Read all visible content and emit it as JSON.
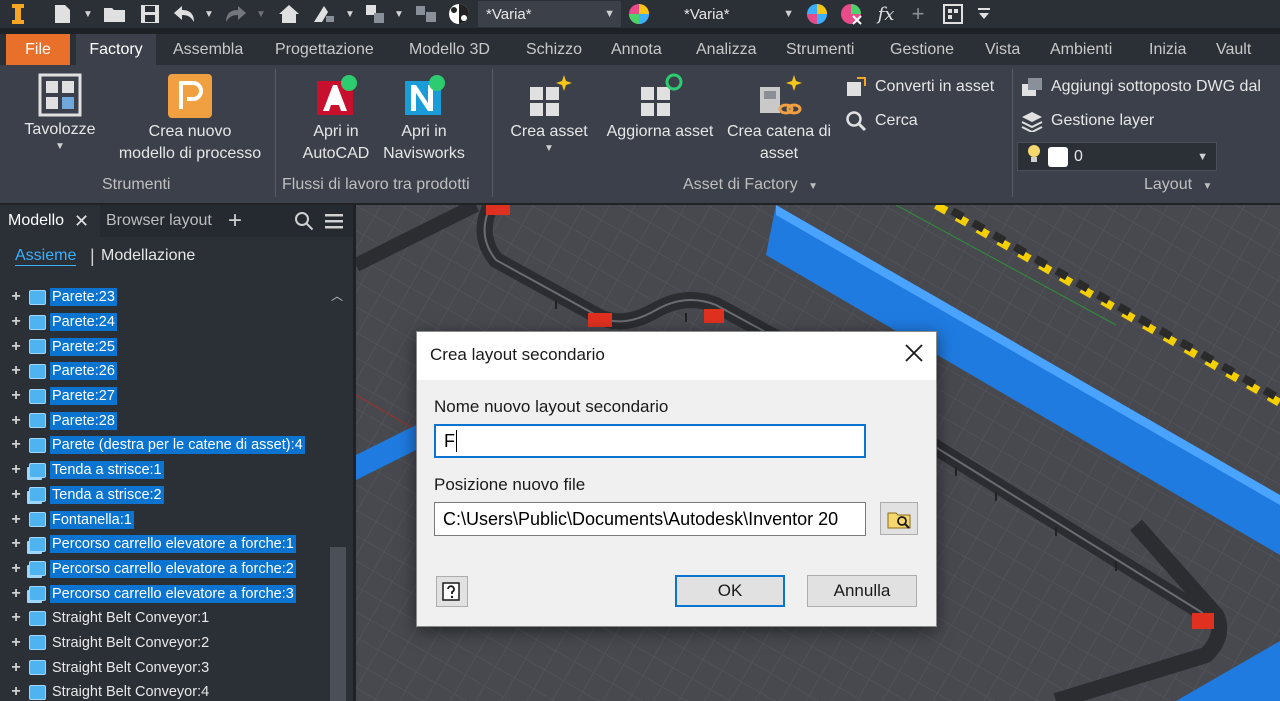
{
  "quick_access": {
    "style_select_1": "*Varia*",
    "style_select_2": "*Varia*",
    "fx_label": "fx"
  },
  "ribbon_tabs": [
    "File",
    "Factory",
    "Assembla",
    "Progettazione",
    "Modello 3D",
    "Schizzo",
    "Annota",
    "Analizza",
    "Strumenti",
    "Gestione",
    "Vista",
    "Ambienti",
    "Inizia",
    "Vault"
  ],
  "active_tab": "Factory",
  "ribbon": {
    "tavolozze": "Tavolozze",
    "crea_nuovo_1": "Crea nuovo",
    "crea_nuovo_2": "modello di processo",
    "apri_autocad_1": "Apri in",
    "apri_autocad_2": "AutoCAD",
    "apri_navis_1": "Apri in",
    "apri_navis_2": "Navisworks",
    "crea_asset": "Crea asset",
    "aggiorna_asset": "Aggiorna asset",
    "crea_catena_1": "Crea catena di",
    "crea_catena_2": "asset",
    "converti": "Converti in asset",
    "cerca": "Cerca",
    "aggiungi_dwg": "Aggiungi sottoposto DWG dal",
    "gestione_layer": "Gestione layer",
    "layer_value": "0",
    "panel_strumenti": "Strumenti",
    "panel_flussi": "Flussi di lavoro tra prodotti",
    "panel_asset": "Asset di Factory",
    "panel_layout": "Layout"
  },
  "browser": {
    "tab_modello": "Modello",
    "tab_layout": "Browser layout",
    "sub_assieme": "Assieme",
    "sub_modellazione": "Modellazione",
    "items": [
      {
        "label": "Parete:23",
        "hl": true,
        "multi": false
      },
      {
        "label": "Parete:24",
        "hl": true,
        "multi": false
      },
      {
        "label": "Parete:25",
        "hl": true,
        "multi": false
      },
      {
        "label": "Parete:26",
        "hl": true,
        "multi": false
      },
      {
        "label": "Parete:27",
        "hl": true,
        "multi": false
      },
      {
        "label": "Parete:28",
        "hl": true,
        "multi": false
      },
      {
        "label": "Parete (destra per le catene di asset):4",
        "hl": true,
        "multi": false
      },
      {
        "label": "Tenda a strisce:1",
        "hl": true,
        "multi": true
      },
      {
        "label": "Tenda a strisce:2",
        "hl": true,
        "multi": true
      },
      {
        "label": "Fontanella:1",
        "hl": true,
        "multi": false
      },
      {
        "label": "Percorso carrello elevatore a forche:1",
        "hl": true,
        "multi": true
      },
      {
        "label": "Percorso carrello elevatore a forche:2",
        "hl": true,
        "multi": true
      },
      {
        "label": "Percorso carrello elevatore a forche:3",
        "hl": true,
        "multi": true
      },
      {
        "label": "Straight Belt Conveyor:1",
        "hl": false,
        "multi": false
      },
      {
        "label": "Straight Belt Conveyor:2",
        "hl": false,
        "multi": false
      },
      {
        "label": "Straight Belt Conveyor:3",
        "hl": false,
        "multi": false
      },
      {
        "label": "Straight Belt Conveyor:4",
        "hl": false,
        "multi": false
      }
    ]
  },
  "dialog": {
    "title": "Crea layout secondario",
    "name_label": "Nome nuovo layout secondario",
    "name_value": "F",
    "path_label": "Posizione nuovo file",
    "path_value": "C:\\Users\\Public\\Documents\\Autodesk\\Inventor 20",
    "ok": "OK",
    "cancel": "Annulla"
  }
}
